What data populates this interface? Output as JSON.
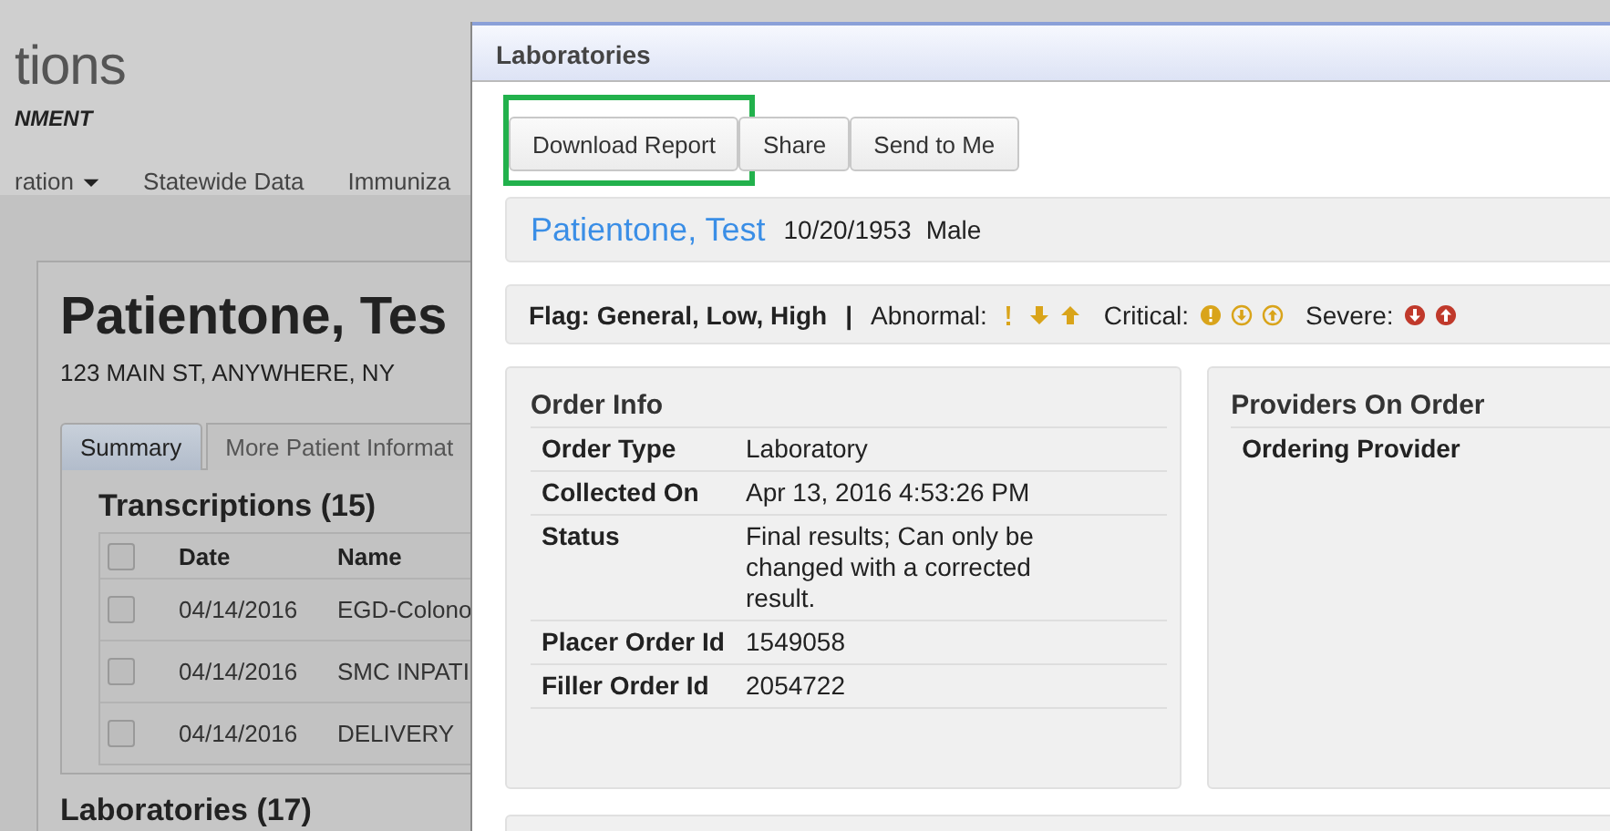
{
  "background_page": {
    "brand": "tions",
    "brand_subtitle": "NMENT",
    "nav": [
      {
        "label": "ration",
        "dropdown": true
      },
      {
        "label": "Statewide Data",
        "dropdown": false
      },
      {
        "label": "Immuniza",
        "dropdown": false
      }
    ],
    "patient_name": "Patientone, Tes",
    "address": "123 MAIN ST, ANYWHERE, NY",
    "tabs": [
      {
        "label": "Summary",
        "selected": true
      },
      {
        "label": "More Patient Informat",
        "selected": false
      }
    ],
    "section_title": "Transcriptions (15)",
    "table": {
      "columns": [
        "Date",
        "Name"
      ],
      "header_checked": false,
      "rows": [
        {
          "checked": false,
          "cells": [
            "04/14/2016",
            "EGD-Colono"
          ]
        },
        {
          "checked": false,
          "cells": [
            "04/14/2016",
            "SMC INPATI"
          ]
        },
        {
          "checked": false,
          "cells": [
            "04/14/2016",
            "DELIVERY"
          ]
        }
      ]
    },
    "next_section_title": "Laboratories (17)"
  },
  "dialog": {
    "title": "Laboratories",
    "buttons": [
      {
        "label": "Download Report",
        "highlighted": true
      },
      {
        "label": "Share",
        "highlighted": false
      },
      {
        "label": "Send to Me",
        "highlighted": false
      }
    ],
    "patient": {
      "name": "Patientone, Test",
      "dob": "10/20/1953",
      "sex": "Male"
    },
    "flag_bar": {
      "label": "Flag: General, Low, High",
      "separator": "|",
      "legends": [
        {
          "label": "Abnormal:",
          "kind": "abnormal"
        },
        {
          "label": "Critical:",
          "kind": "critical"
        },
        {
          "label": "Severe:",
          "kind": "severe"
        }
      ]
    },
    "order_info": {
      "title": "Order Info",
      "rows": [
        {
          "label": "Order Type",
          "value": "Laboratory"
        },
        {
          "label": "Collected On",
          "value": "Apr 13, 2016 4:53:26 PM"
        },
        {
          "label": "Status",
          "value": "Final results; Can only be changed with a corrected result."
        },
        {
          "label": "Placer Order Id",
          "value": "1549058"
        },
        {
          "label": "Filler Order Id",
          "value": "2054722"
        }
      ]
    },
    "providers": {
      "title": "Providers On Order",
      "rows": [
        {
          "label": "Ordering Provider"
        }
      ]
    }
  }
}
